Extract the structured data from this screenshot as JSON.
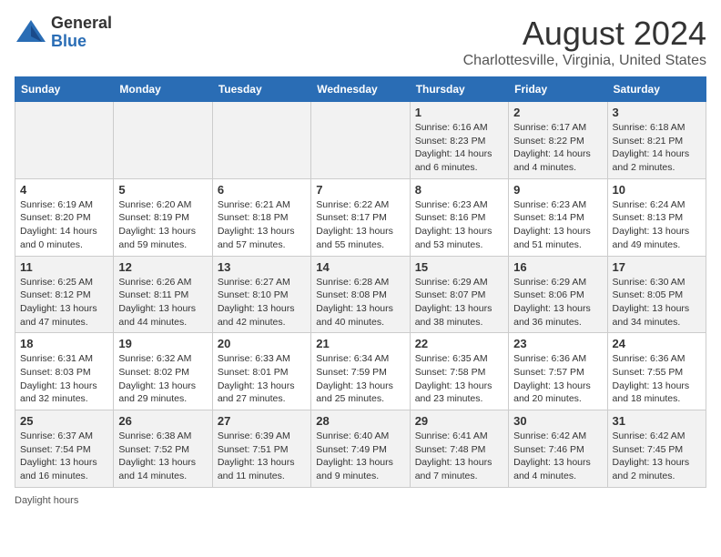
{
  "logo": {
    "general": "General",
    "blue": "Blue"
  },
  "title": "August 2024",
  "subtitle": "Charlottesville, Virginia, United States",
  "days_of_week": [
    "Sunday",
    "Monday",
    "Tuesday",
    "Wednesday",
    "Thursday",
    "Friday",
    "Saturday"
  ],
  "weeks": [
    [
      {
        "day": "",
        "info": ""
      },
      {
        "day": "",
        "info": ""
      },
      {
        "day": "",
        "info": ""
      },
      {
        "day": "",
        "info": ""
      },
      {
        "day": "1",
        "info": "Sunrise: 6:16 AM\nSunset: 8:23 PM\nDaylight: 14 hours\nand 6 minutes."
      },
      {
        "day": "2",
        "info": "Sunrise: 6:17 AM\nSunset: 8:22 PM\nDaylight: 14 hours\nand 4 minutes."
      },
      {
        "day": "3",
        "info": "Sunrise: 6:18 AM\nSunset: 8:21 PM\nDaylight: 14 hours\nand 2 minutes."
      }
    ],
    [
      {
        "day": "4",
        "info": "Sunrise: 6:19 AM\nSunset: 8:20 PM\nDaylight: 14 hours\nand 0 minutes."
      },
      {
        "day": "5",
        "info": "Sunrise: 6:20 AM\nSunset: 8:19 PM\nDaylight: 13 hours\nand 59 minutes."
      },
      {
        "day": "6",
        "info": "Sunrise: 6:21 AM\nSunset: 8:18 PM\nDaylight: 13 hours\nand 57 minutes."
      },
      {
        "day": "7",
        "info": "Sunrise: 6:22 AM\nSunset: 8:17 PM\nDaylight: 13 hours\nand 55 minutes."
      },
      {
        "day": "8",
        "info": "Sunrise: 6:23 AM\nSunset: 8:16 PM\nDaylight: 13 hours\nand 53 minutes."
      },
      {
        "day": "9",
        "info": "Sunrise: 6:23 AM\nSunset: 8:14 PM\nDaylight: 13 hours\nand 51 minutes."
      },
      {
        "day": "10",
        "info": "Sunrise: 6:24 AM\nSunset: 8:13 PM\nDaylight: 13 hours\nand 49 minutes."
      }
    ],
    [
      {
        "day": "11",
        "info": "Sunrise: 6:25 AM\nSunset: 8:12 PM\nDaylight: 13 hours\nand 47 minutes."
      },
      {
        "day": "12",
        "info": "Sunrise: 6:26 AM\nSunset: 8:11 PM\nDaylight: 13 hours\nand 44 minutes."
      },
      {
        "day": "13",
        "info": "Sunrise: 6:27 AM\nSunset: 8:10 PM\nDaylight: 13 hours\nand 42 minutes."
      },
      {
        "day": "14",
        "info": "Sunrise: 6:28 AM\nSunset: 8:08 PM\nDaylight: 13 hours\nand 40 minutes."
      },
      {
        "day": "15",
        "info": "Sunrise: 6:29 AM\nSunset: 8:07 PM\nDaylight: 13 hours\nand 38 minutes."
      },
      {
        "day": "16",
        "info": "Sunrise: 6:29 AM\nSunset: 8:06 PM\nDaylight: 13 hours\nand 36 minutes."
      },
      {
        "day": "17",
        "info": "Sunrise: 6:30 AM\nSunset: 8:05 PM\nDaylight: 13 hours\nand 34 minutes."
      }
    ],
    [
      {
        "day": "18",
        "info": "Sunrise: 6:31 AM\nSunset: 8:03 PM\nDaylight: 13 hours\nand 32 minutes."
      },
      {
        "day": "19",
        "info": "Sunrise: 6:32 AM\nSunset: 8:02 PM\nDaylight: 13 hours\nand 29 minutes."
      },
      {
        "day": "20",
        "info": "Sunrise: 6:33 AM\nSunset: 8:01 PM\nDaylight: 13 hours\nand 27 minutes."
      },
      {
        "day": "21",
        "info": "Sunrise: 6:34 AM\nSunset: 7:59 PM\nDaylight: 13 hours\nand 25 minutes."
      },
      {
        "day": "22",
        "info": "Sunrise: 6:35 AM\nSunset: 7:58 PM\nDaylight: 13 hours\nand 23 minutes."
      },
      {
        "day": "23",
        "info": "Sunrise: 6:36 AM\nSunset: 7:57 PM\nDaylight: 13 hours\nand 20 minutes."
      },
      {
        "day": "24",
        "info": "Sunrise: 6:36 AM\nSunset: 7:55 PM\nDaylight: 13 hours\nand 18 minutes."
      }
    ],
    [
      {
        "day": "25",
        "info": "Sunrise: 6:37 AM\nSunset: 7:54 PM\nDaylight: 13 hours\nand 16 minutes."
      },
      {
        "day": "26",
        "info": "Sunrise: 6:38 AM\nSunset: 7:52 PM\nDaylight: 13 hours\nand 14 minutes."
      },
      {
        "day": "27",
        "info": "Sunrise: 6:39 AM\nSunset: 7:51 PM\nDaylight: 13 hours\nand 11 minutes."
      },
      {
        "day": "28",
        "info": "Sunrise: 6:40 AM\nSunset: 7:49 PM\nDaylight: 13 hours\nand 9 minutes."
      },
      {
        "day": "29",
        "info": "Sunrise: 6:41 AM\nSunset: 7:48 PM\nDaylight: 13 hours\nand 7 minutes."
      },
      {
        "day": "30",
        "info": "Sunrise: 6:42 AM\nSunset: 7:46 PM\nDaylight: 13 hours\nand 4 minutes."
      },
      {
        "day": "31",
        "info": "Sunrise: 6:42 AM\nSunset: 7:45 PM\nDaylight: 13 hours\nand 2 minutes."
      }
    ]
  ],
  "footer": "Daylight hours"
}
